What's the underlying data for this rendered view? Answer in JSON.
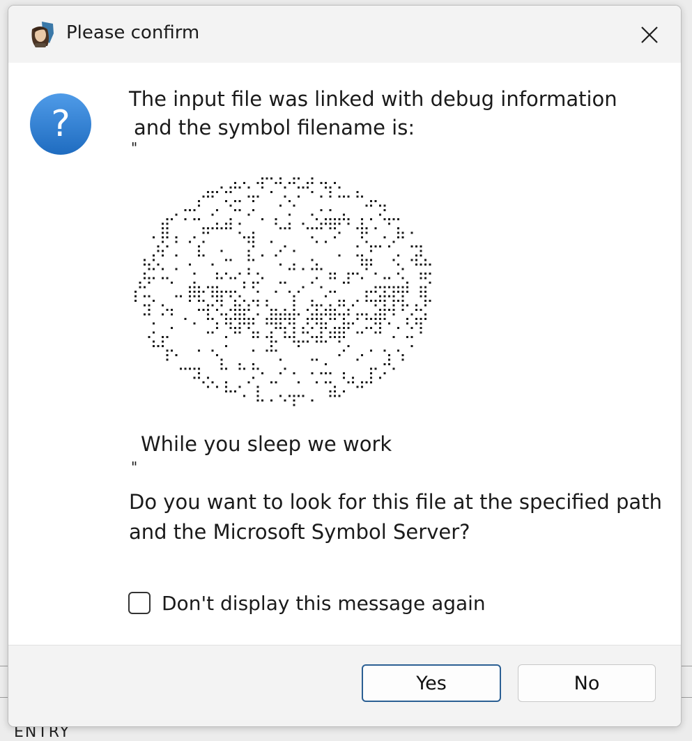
{
  "dialog": {
    "title": "Please confirm",
    "app_icon": "app-avatar-icon",
    "close_icon": "close-icon",
    "question_icon": "question-icon",
    "accent_color": "#2f7fd4",
    "message_line1": "The input file was linked with debug information",
    "message_line2": "and the symbol filename is:",
    "open_quote": "\"",
    "ascii_art": "dotted-face-art",
    "filename_text": "While you sleep we work",
    "close_quote": "\"",
    "prompt_line1": "Do you want to look for this file at the specified path",
    "prompt_line2": "and the Microsoft Symbol Server?",
    "checkbox_label": "Don't display this message again",
    "checkbox_checked": false,
    "yes_label": "Yes",
    "no_label": "No"
  },
  "background": {
    "partial_text": "ENTRY"
  }
}
